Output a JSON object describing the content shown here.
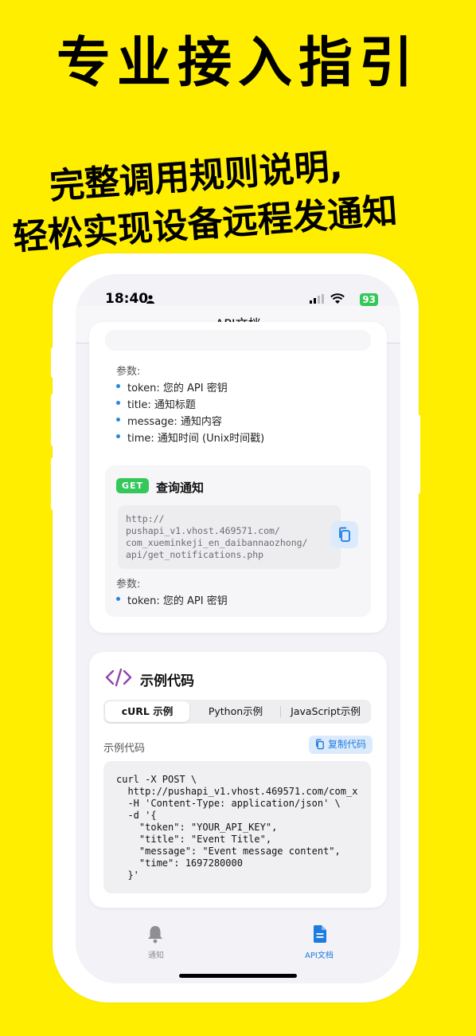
{
  "promo": {
    "headline": "专业接入指引",
    "line1": "完整调用规则说明,",
    "line2": "轻松实现设备远程发通知"
  },
  "status_bar": {
    "time": "18:40",
    "battery": "93"
  },
  "nav": {
    "title": "API文档"
  },
  "endpoint1": {
    "params_label": "参数:",
    "params": [
      "token: 您的 API 密钥",
      "title: 通知标题",
      "message: 通知内容",
      "time: 通知时间 (Unix时间戳)"
    ]
  },
  "endpoint2": {
    "method": "GET",
    "title": "查询通知",
    "url_lines": [
      "http://",
      "pushapi_v1.vhost.469571.com/",
      "com_xueminkeji_en_daibannaozhong/",
      "api/get_notifications.php"
    ],
    "params_label": "参数:",
    "params": [
      "token: 您的 API 密钥"
    ]
  },
  "code_section": {
    "title": "示例代码",
    "tabs": [
      "cURL 示例",
      "Python示例",
      "JavaScript示例"
    ],
    "active_tab": 0,
    "caption": "示例代码",
    "copy_label": "复制代码",
    "code_lines": [
      "curl -X POST \\",
      "  http://pushapi_v1.vhost.469571.com/com_x",
      "  -H 'Content-Type: application/json' \\",
      "  -d '{",
      "    \"token\": \"YOUR_API_KEY\",",
      "    \"title\": \"Event Title\",",
      "    \"message\": \"Event message content\",",
      "    \"time\": 1697280000",
      "  }'"
    ]
  },
  "tabbar": {
    "items": [
      {
        "label": "通知",
        "icon": "bell-icon",
        "active": false
      },
      {
        "label": "API文档",
        "icon": "document-icon",
        "active": true
      }
    ]
  },
  "colors": {
    "background": "#FFEE00",
    "accent": "#1E7BE0",
    "get_badge": "#34C759",
    "code_icon": "#8E44AD"
  }
}
